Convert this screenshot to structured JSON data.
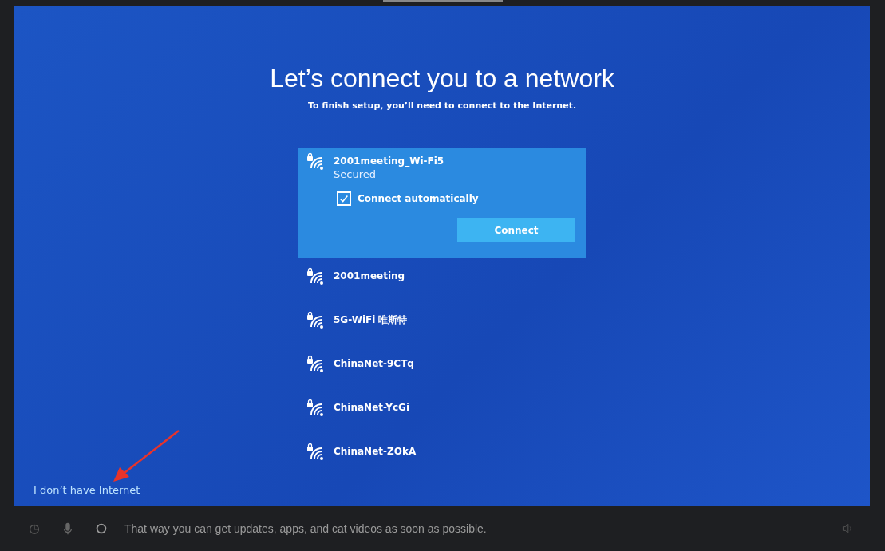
{
  "title": "Let’s connect you to a network",
  "subtitle": "To finish setup, you’ll need to connect to the Internet.",
  "networks": [
    {
      "name": "2001meeting_Wi-Fi5",
      "selected": true,
      "status": "Secured",
      "auto_connect": {
        "label": "Connect automatically",
        "checked": true
      },
      "button": "Connect"
    },
    {
      "name": "2001meeting",
      "selected": false
    },
    {
      "name": "5G-WiFi 唯斯特",
      "selected": false
    },
    {
      "name": "ChinaNet-9CTq",
      "selected": false
    },
    {
      "name": "ChinaNet-YcGi",
      "selected": false
    },
    {
      "name": "ChinaNet-ZOkA",
      "selected": false
    }
  ],
  "skip_link": "I don’t have Internet",
  "taskbar": {
    "caption": "That way you can get updates, apps, and cat videos as soon as possible."
  }
}
